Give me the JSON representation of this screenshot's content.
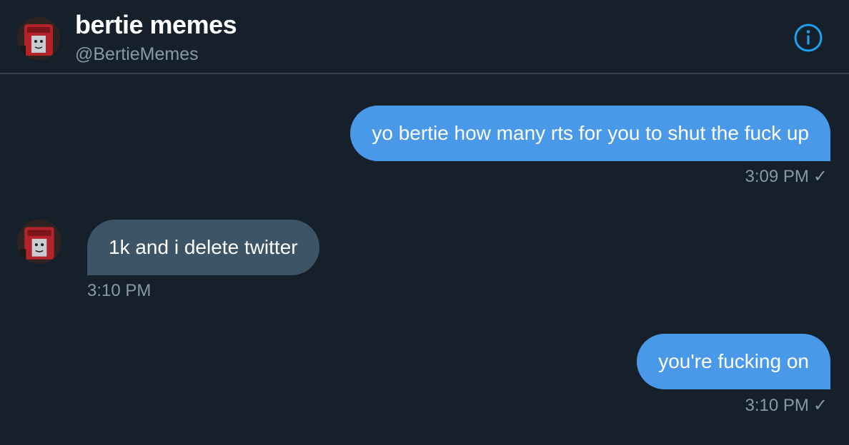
{
  "header": {
    "name": "bertie memes",
    "handle": "@BertieMemes",
    "info_icon": "info-icon"
  },
  "messages": [
    {
      "direction": "sent",
      "text": "yo bertie how many rts for you to shut the fuck up",
      "time": "3:09 PM",
      "status_icon": "✓"
    },
    {
      "direction": "received",
      "text": "1k and i delete twitter",
      "time": "3:10 PM"
    },
    {
      "direction": "sent",
      "text": "you're fucking on",
      "time": "3:10 PM",
      "status_icon": "✓"
    }
  ],
  "colors": {
    "background": "#15202b",
    "sent_bubble": "#4a99e9",
    "received_bubble": "#3d5466",
    "secondary_text": "#8899a6",
    "accent": "#1da1f2"
  }
}
